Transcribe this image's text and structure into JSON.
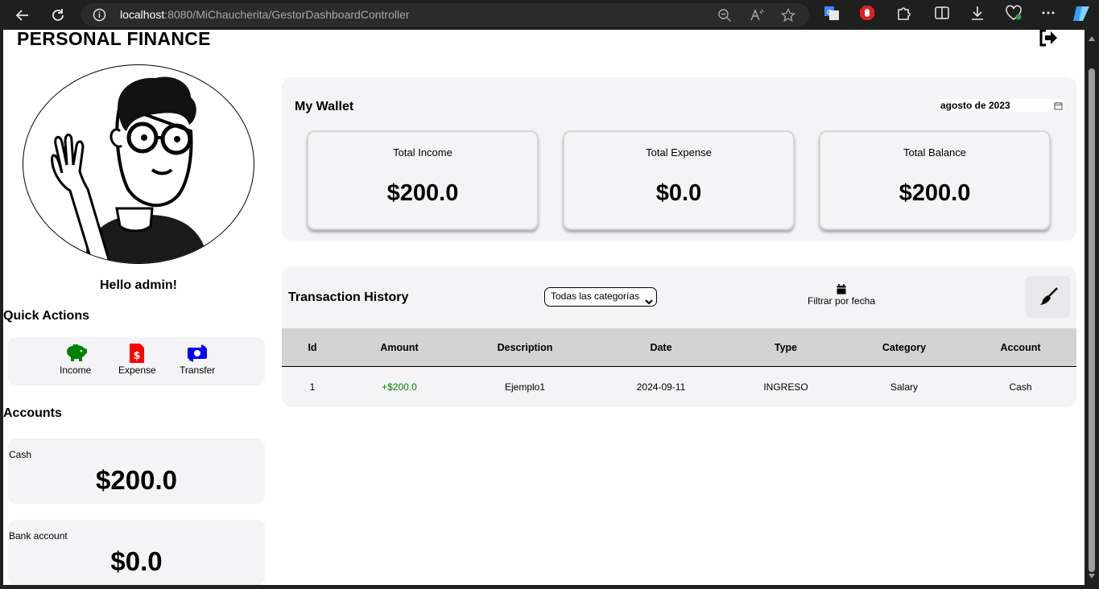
{
  "browser": {
    "url_host": "localhost",
    "url_rest": ":8080/MiChaucherita/GestorDashboardController"
  },
  "header": {
    "brand": "PERSONAL FINANCE"
  },
  "sidebar": {
    "greeting": "Hello admin!",
    "quick_actions_title": "Quick Actions",
    "quick_actions": [
      {
        "label": "Income",
        "icon": "piggy-bank-icon",
        "color": "#008000"
      },
      {
        "label": "Expense",
        "icon": "dollar-file-icon",
        "color": "#ff0000"
      },
      {
        "label": "Transfer",
        "icon": "money-transfer-icon",
        "color": "#0000ff"
      }
    ],
    "accounts_title": "Accounts",
    "accounts": [
      {
        "name": "Cash",
        "balance": "$200.0"
      },
      {
        "name": "Bank account",
        "balance": "$0.0"
      }
    ]
  },
  "wallet": {
    "title": "My Wallet",
    "month": "agosto de 2023",
    "cards": [
      {
        "label": "Total Income",
        "value": "$200.0"
      },
      {
        "label": "Total Expense",
        "value": "$0.0"
      },
      {
        "label": "Total Balance",
        "value": "$200.0"
      }
    ]
  },
  "transactions": {
    "title": "Transaction History",
    "category_filter": "Todas las categorías",
    "date_filter_label": "Filtrar por fecha",
    "columns": [
      "Id",
      "Amount",
      "Description",
      "Date",
      "Type",
      "Category",
      "Account"
    ],
    "rows": [
      {
        "id": "1",
        "amount": "+$200.0",
        "description": "Ejemplo1",
        "date": "2024-09-11",
        "type": "INGRESO",
        "category": "Salary",
        "account": "Cash"
      }
    ],
    "income_color": "#008000"
  }
}
